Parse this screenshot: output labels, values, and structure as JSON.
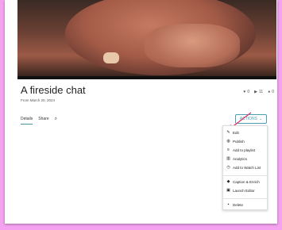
{
  "video": {
    "title": "A fireside chat",
    "from_prefix": "From",
    "owner": "",
    "date": "March 20, 2024"
  },
  "stats": {
    "likes": "0",
    "plays": "11",
    "comments": "0"
  },
  "tabs": [
    {
      "label": "Details"
    },
    {
      "label": "Share"
    }
  ],
  "actions": {
    "label": "ACTIONS"
  },
  "menu": {
    "items": [
      {
        "label": "Edit",
        "icon": "pencil-icon"
      },
      {
        "label": "Publish",
        "icon": "globe-icon"
      },
      {
        "label": "Add to playlist",
        "icon": "playlist-icon"
      },
      {
        "label": "Analytics",
        "icon": "analytics-icon"
      },
      {
        "label": "Add to Watch List",
        "icon": "clock-icon"
      },
      {
        "label": "Caption & Enrich",
        "icon": "enrich-icon"
      },
      {
        "label": "Launch Editor",
        "icon": "editor-icon"
      },
      {
        "label": "Delete",
        "icon": "trash-icon"
      }
    ]
  },
  "colors": {
    "accent": "#4aa0b0",
    "arrow": "#e0306a",
    "background": "#f5a3f0"
  }
}
